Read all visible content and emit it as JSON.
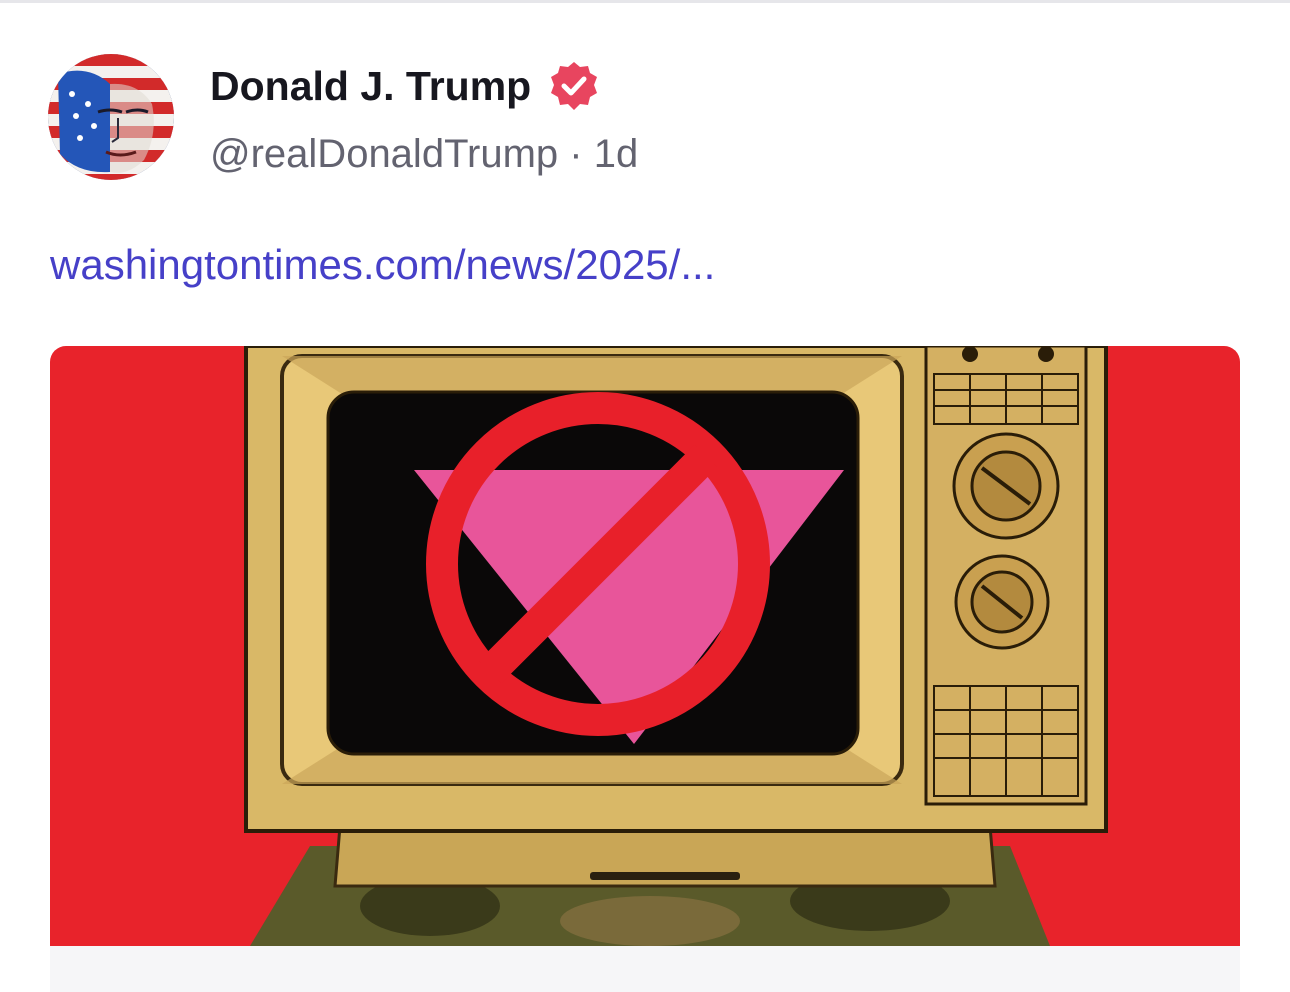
{
  "post": {
    "author": {
      "display_name": "Donald J. Trump",
      "handle": "@realDonaldTrump",
      "separator": " · ",
      "time_ago": "1d",
      "verified": true,
      "avatar_icon": "flag-face-avatar"
    },
    "link_text": "washingtontimes.com/news/2025/...",
    "link_card": {
      "image_description_icon": "tv-prohibited-pink-triangle-illustration"
    }
  },
  "colors": {
    "name_text": "#17171f",
    "handle_text": "#636370",
    "link_text": "#4640c8",
    "verified_badge": "#e8455f",
    "card_bg_red": "#e8232b",
    "tv_tan": "#e8c878",
    "screen_black": "#0a0808",
    "prohibit_red": "#e8202a",
    "triangle_pink": "#e8559a"
  }
}
